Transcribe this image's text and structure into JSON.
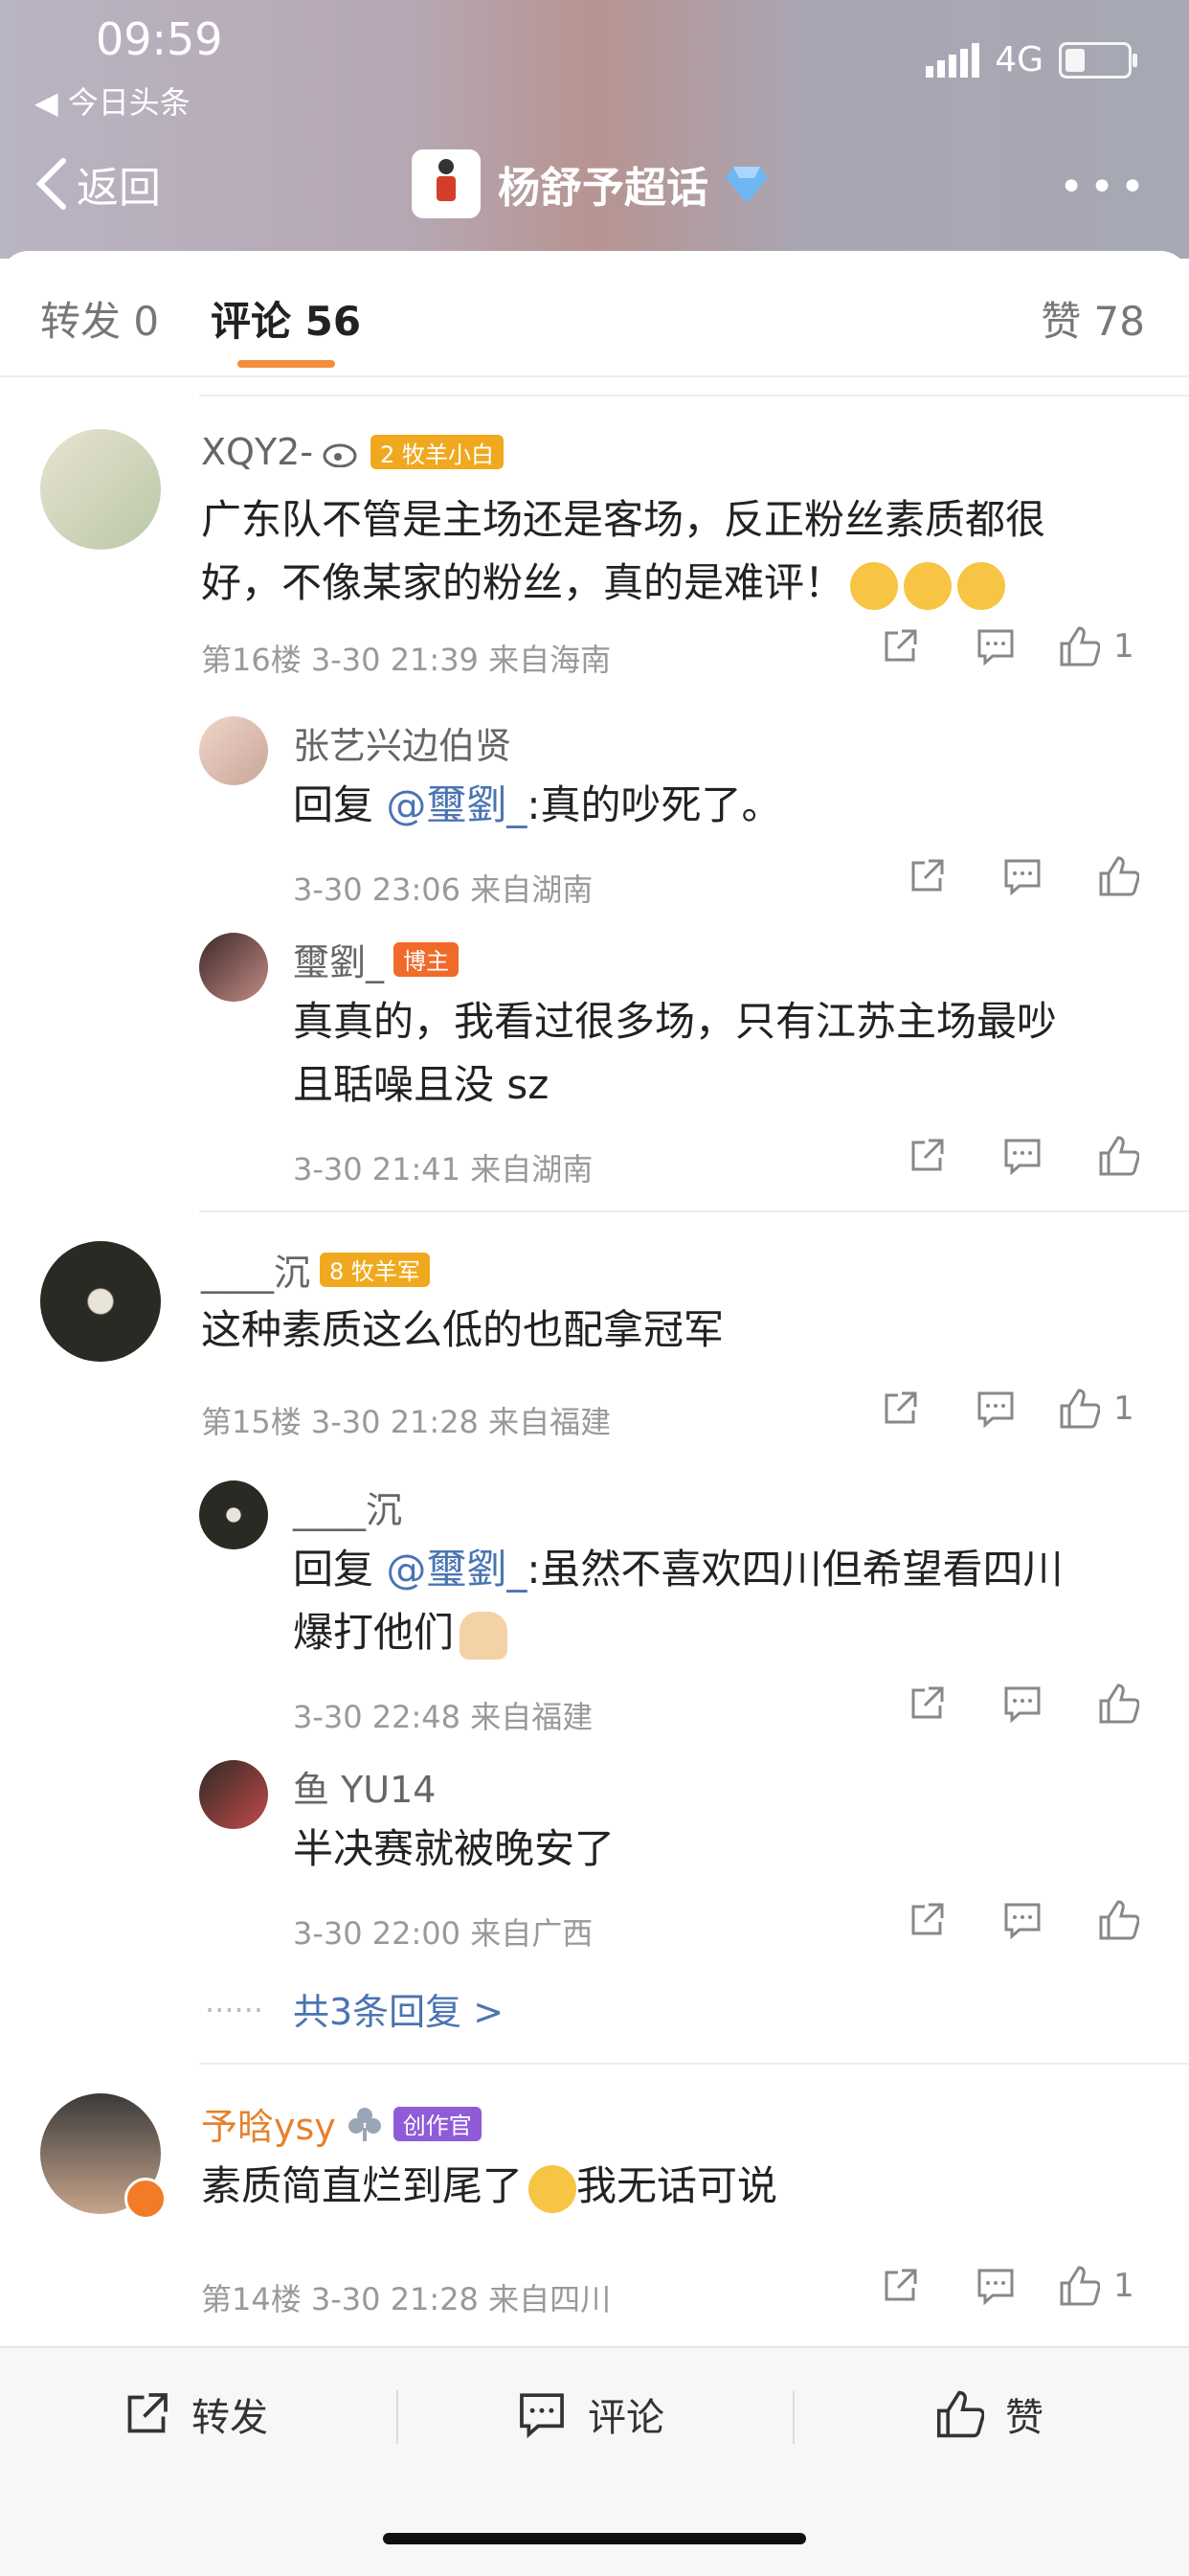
{
  "status": {
    "time": "09:59",
    "back_app": "◀ 今日头条",
    "network": "4G"
  },
  "nav": {
    "back": "返回",
    "title": "杨舒予超话",
    "more": "•••"
  },
  "tabs": {
    "repost": "转发 0",
    "comment": "评论 56",
    "like": "赞 78"
  },
  "comments": [
    {
      "name": "XQY2-",
      "badge": "2 牧羊小白",
      "text1": "广东队不管是主场还是客场，反正粉丝素质都很",
      "text2": "好，不像某家的粉丝，真的是难评！",
      "meta": "第16楼  3-30 21:39  来自海南",
      "likes": "1"
    },
    {
      "name": "____沉",
      "badge": "8 牧羊军",
      "text1": "这种素质这么低的也配拿冠军",
      "meta": "第15楼  3-30 21:28  来自福建",
      "likes": "1"
    },
    {
      "name": "予晗ysy",
      "badge": "创作官",
      "text1": "素质简直烂到尾了",
      "text1b": "我无话可说",
      "meta": "第14楼  3-30 21:28  来自四川",
      "likes": "1"
    }
  ],
  "replies": [
    {
      "name": "张艺兴边伯贤",
      "prefix": "回复",
      "mention": "@璽劉_",
      "text": ":真的吵死了。",
      "meta": "3-30 23:06  来自湖南"
    },
    {
      "name": "璽劉_",
      "badge": "博主",
      "text1": "真真的，我看过很多场，只有江苏主场最吵",
      "text2": "且聒噪且没 sz",
      "meta": "3-30 21:41  来自湖南"
    },
    {
      "name": "____沉",
      "prefix": "回复",
      "mention": "@璽劉_",
      "text": ":虽然不喜欢四川但希望看四川",
      "text2": "爆打他们",
      "meta": "3-30 22:48  来自福建"
    },
    {
      "name": "鱼 YU14",
      "text1": "半决赛就被晚安了",
      "meta": "3-30 22:00  来自广西"
    }
  ],
  "more_replies": "共3条回复 >",
  "more_dots": "······",
  "bottom": {
    "repost": "转发",
    "comment": "评论",
    "like": "赞"
  }
}
